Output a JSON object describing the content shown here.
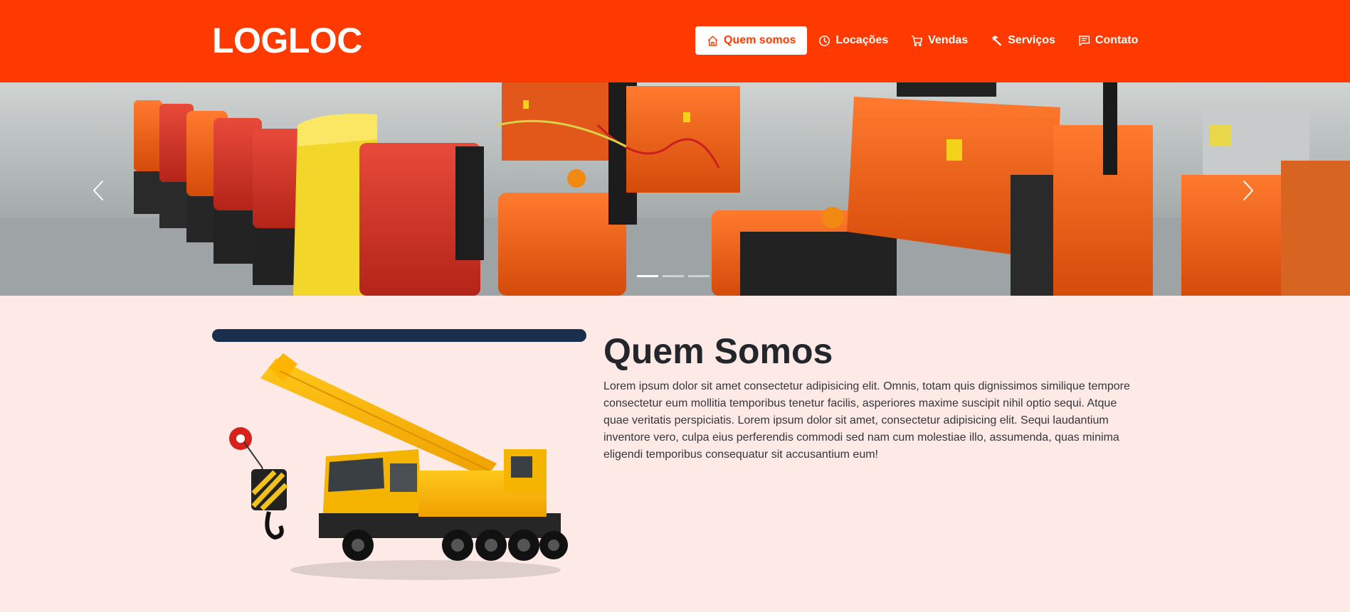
{
  "brand": {
    "logo": "LOGLOC",
    "accent": "#ff3a00",
    "bar_color": "#1a2e4e",
    "page_bg": "#fde9e5"
  },
  "nav": {
    "items": [
      {
        "label": "Quem somos",
        "icon": "home-icon",
        "active": true
      },
      {
        "label": "Locações",
        "icon": "clock-icon",
        "active": false
      },
      {
        "label": "Vendas",
        "icon": "cart-icon",
        "active": false
      },
      {
        "label": "Serviços",
        "icon": "hammer-icon",
        "active": false
      },
      {
        "label": "Contato",
        "icon": "message-icon",
        "active": false
      }
    ]
  },
  "carousel": {
    "slides": 3,
    "active_slide": 1,
    "prev_icon": "chevron-left-icon",
    "next_icon": "chevron-right-icon"
  },
  "about": {
    "title": "Quem Somos",
    "text": "Lorem ipsum dolor sit amet consectetur adipisicing elit. Omnis, totam quis dignissimos similique tempore consectetur eum mollitia temporibus tenetur facilis, asperiores maxime suscipit nihil optio sequi. Atque quae veritatis perspiciatis. Lorem ipsum dolor sit amet, consectetur adipisicing elit. Sequi laudantium inventore vero, culpa eius perferendis commodi sed nam cum molestiae illo, assumenda, quas minima eligendi temporibus consequatur sit accusantium eum!"
  }
}
